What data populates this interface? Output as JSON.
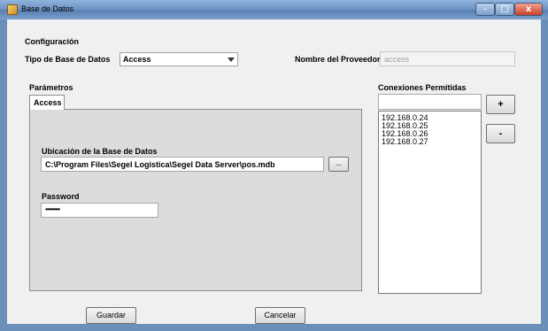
{
  "window": {
    "title": "Base de Datos",
    "controls": {
      "minimize": "–",
      "maximize": "□",
      "close": "x"
    }
  },
  "config": {
    "section_label": "Configuración",
    "db_type_label": "Tipo de Base de Datos",
    "db_type_value": "Access",
    "provider_label": "Nombre del Proveedor",
    "provider_value": "access"
  },
  "params": {
    "section_label": "Parámetros",
    "tab_label": "Access",
    "db_location_label": "Ubicación de la Base de Datos",
    "db_location_value": "C:\\Program Files\\Segel Logistica\\Segel Data Server\\pos.mdb",
    "browse_label": "...",
    "password_label": "Password",
    "password_value": "•••••••••"
  },
  "connections": {
    "section_label": "Conexiones Permitidas",
    "new_ip_value": "",
    "add_label": "+",
    "remove_label": "-",
    "items": [
      "192.168.0.24",
      "192.168.0.25",
      "192.168.0.26",
      "192.168.0.27"
    ]
  },
  "footer": {
    "save_label": "Guardar",
    "cancel_label": "Cancelar"
  }
}
